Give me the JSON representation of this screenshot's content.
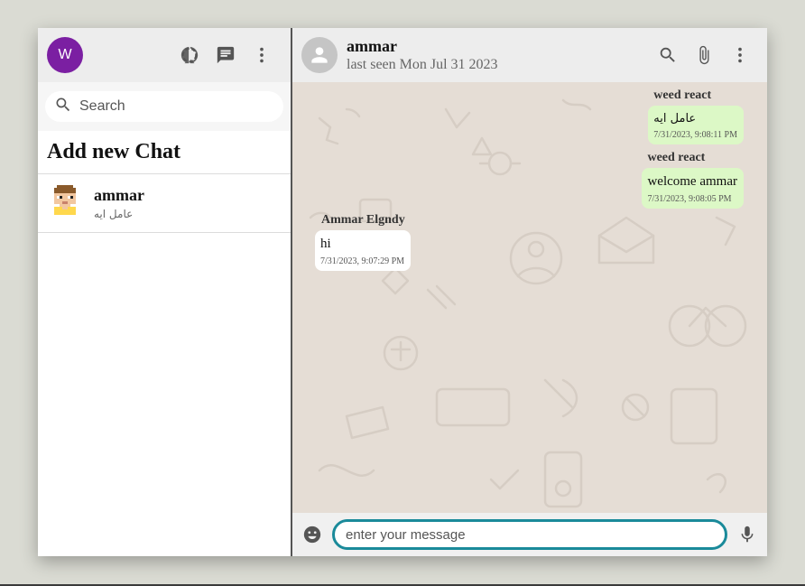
{
  "sidebar": {
    "user_initial": "W",
    "search": {
      "placeholder": "Search"
    },
    "add_chat_label": "Add new Chat",
    "chats": [
      {
        "name": "ammar",
        "last_message": "عامل ايه"
      }
    ]
  },
  "chat": {
    "contact_name": "ammar",
    "status": "last seen Mon Jul 31 2023",
    "messages": [
      {
        "sender": "weed react",
        "text": "عامل ايه",
        "time": "7/31/2023, 9:08:11 PM",
        "direction": "out"
      },
      {
        "sender": "weed react",
        "text": "welcome ammar",
        "time": "7/31/2023, 9:08:05 PM",
        "direction": "out"
      },
      {
        "sender": "Ammar Elgndy",
        "text": "hi",
        "time": "7/31/2023, 9:07:29 PM",
        "direction": "in"
      }
    ],
    "composer": {
      "placeholder": "enter your message"
    }
  },
  "icons": {
    "status": "status-icon",
    "new_chat": "chat-icon",
    "menu": "more-vert-icon",
    "search": "search-icon",
    "attach": "paperclip-icon",
    "emoji": "emoji-icon",
    "mic": "mic-icon"
  },
  "colors": {
    "user_avatar": "#7b1fa2",
    "outgoing_bubble": "#dcf8c6",
    "incoming_bubble": "#ffffff",
    "chat_background": "#e5ddd5",
    "composer_border": "#1a8a9a"
  }
}
